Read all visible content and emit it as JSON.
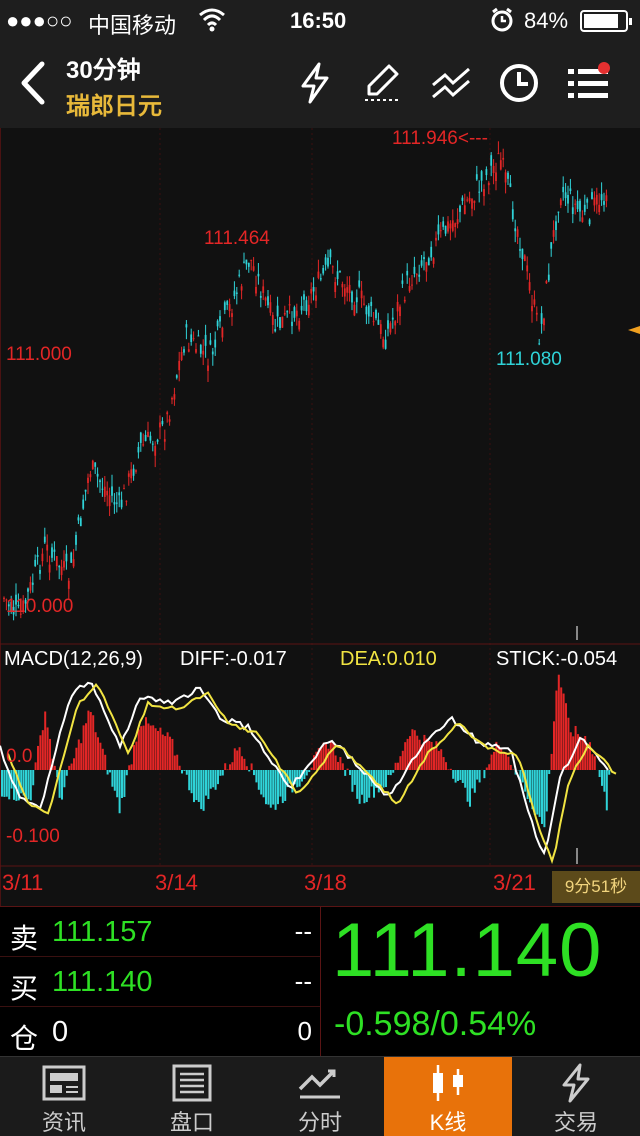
{
  "status_bar": {
    "signal_dots": "●●●○○",
    "carrier": "中国移动",
    "time": "16:50",
    "battery_pct": "84%",
    "battery_level": 0.84,
    "icons": [
      "wifi-icon",
      "alarm-icon",
      "battery-icon"
    ]
  },
  "nav": {
    "period": "30分钟",
    "symbol": "瑞郎日元",
    "icons": [
      "back-icon",
      "flash-icon",
      "draw-icon",
      "trendline-icon",
      "clock-icon",
      "menu-icon"
    ],
    "accent": "#e8b93a",
    "notification_dot_color": "#e43030"
  },
  "chart": {
    "annotations": {
      "high": "111.946<---",
      "mid_high": "111.464",
      "level": "111.000",
      "bottom": "110.000",
      "low": "111.080"
    },
    "macd": {
      "title": "MACD(12,26,9)",
      "diff": "DIFF:-0.017",
      "dea": "DEA:0.010",
      "stick": "STICK:-0.054",
      "level_top": "0.0",
      "level_bottom": "-0.100"
    },
    "dates": [
      "3/11",
      "3/14",
      "3/18",
      "3/21"
    ],
    "countdown": "9分51秒",
    "colors": {
      "up": "#e32626",
      "down": "#2fd3d8",
      "diff_line": "#ffffff",
      "dea_line": "#f1e442"
    }
  },
  "quote": {
    "sell_label": "卖",
    "sell_price": "111.157",
    "sell_size": "--",
    "buy_label": "买",
    "buy_price": "111.140",
    "buy_size": "--",
    "position_label": "仓",
    "position_value": "0",
    "position_right": "0",
    "last_price": "111.140",
    "change": "-0.598/0.54%",
    "price_color": "#2ee024"
  },
  "tabs": [
    {
      "label": "资讯",
      "icon": "news-icon",
      "active": false
    },
    {
      "label": "盘口",
      "icon": "orderbook-icon",
      "active": false
    },
    {
      "label": "分时",
      "icon": "timeshare-icon",
      "active": false
    },
    {
      "label": "K线",
      "icon": "kline-icon",
      "active": true
    },
    {
      "label": "交易",
      "icon": "trade-icon",
      "active": false
    }
  ],
  "active_tab_color": "#e8720a"
}
